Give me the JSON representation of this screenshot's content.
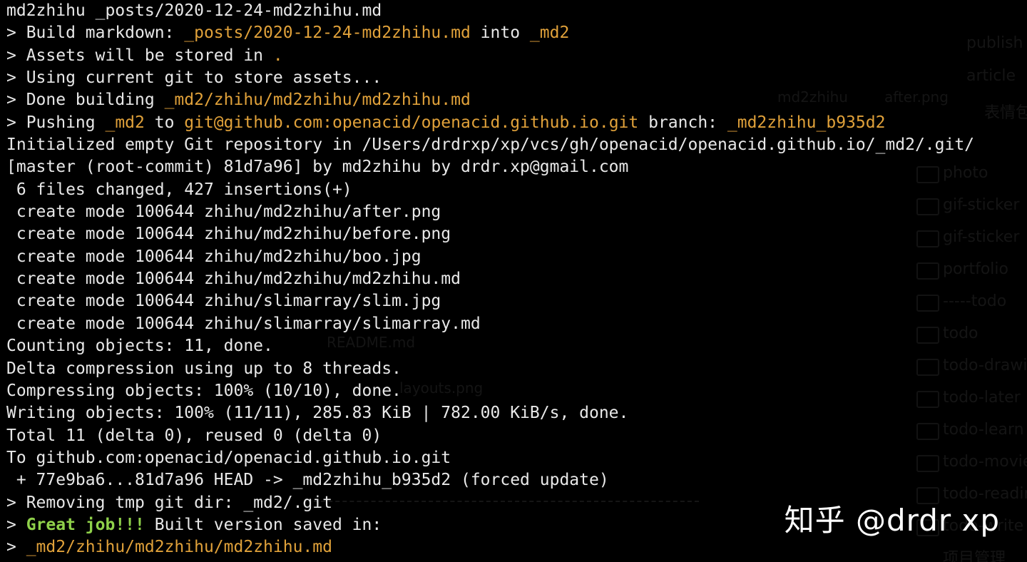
{
  "terminal": {
    "lines": [
      [
        {
          "t": "md2zhihu _posts/2020-12-24-md2zhihu.md",
          "c": "white"
        }
      ],
      [
        {
          "t": "> Build markdown: ",
          "c": "white"
        },
        {
          "t": "_posts/2020-12-24-md2zhihu.md",
          "c": "yellow"
        },
        {
          "t": " into ",
          "c": "white"
        },
        {
          "t": "_md2",
          "c": "yellow"
        }
      ],
      [
        {
          "t": "> Assets will be stored in ",
          "c": "white"
        },
        {
          "t": ".",
          "c": "yellow"
        }
      ],
      [
        {
          "t": "> Using current git to store assets...",
          "c": "white"
        }
      ],
      [
        {
          "t": "> Done building ",
          "c": "white"
        },
        {
          "t": "_md2/zhihu/md2zhihu/md2zhihu.md",
          "c": "yellow"
        }
      ],
      [
        {
          "t": "> Pushing ",
          "c": "white"
        },
        {
          "t": "_md2",
          "c": "yellow"
        },
        {
          "t": " to ",
          "c": "white"
        },
        {
          "t": "git@github.com:openacid/openacid.github.io.git",
          "c": "yellow"
        },
        {
          "t": " branch: ",
          "c": "white"
        },
        {
          "t": "_md2zhihu_b935d2",
          "c": "yellow"
        }
      ],
      [
        {
          "t": "Initialized empty Git repository in /Users/drdrxp/xp/vcs/gh/openacid/openacid.github.io/_md2/.git/",
          "c": "white"
        }
      ],
      [
        {
          "t": "[master (root-commit) 81d7a96] by md2zhihu by drdr.xp@gmail.com",
          "c": "white"
        }
      ],
      [
        {
          "t": " 6 files changed, 427 insertions(+)",
          "c": "white"
        }
      ],
      [
        {
          "t": " create mode 100644 zhihu/md2zhihu/after.png",
          "c": "white"
        }
      ],
      [
        {
          "t": " create mode 100644 zhihu/md2zhihu/before.png",
          "c": "white"
        }
      ],
      [
        {
          "t": " create mode 100644 zhihu/md2zhihu/boo.jpg",
          "c": "white"
        }
      ],
      [
        {
          "t": " create mode 100644 zhihu/md2zhihu/md2zhihu.md",
          "c": "white"
        }
      ],
      [
        {
          "t": " create mode 100644 zhihu/slimarray/slim.jpg",
          "c": "white"
        }
      ],
      [
        {
          "t": " create mode 100644 zhihu/slimarray/slimarray.md",
          "c": "white"
        }
      ],
      [
        {
          "t": "Counting objects: 11, done.",
          "c": "white"
        }
      ],
      [
        {
          "t": "Delta compression using up to 8 threads.",
          "c": "white"
        }
      ],
      [
        {
          "t": "Compressing objects: 100% (10/10), done.",
          "c": "white"
        }
      ],
      [
        {
          "t": "Writing objects: 100% (11/11), 285.83 KiB | 782.00 KiB/s, done.",
          "c": "white"
        }
      ],
      [
        {
          "t": "Total 11 (delta 0), reused 0 (delta 0)",
          "c": "white"
        }
      ],
      [
        {
          "t": "To github.com:openacid/openacid.github.io.git",
          "c": "white"
        }
      ],
      [
        {
          "t": " + 77e9ba6...81d7a96 HEAD -> _md2zhihu_b935d2 (forced update)",
          "c": "white"
        }
      ],
      [
        {
          "t": "> Removing tmp git dir: _md2/.git",
          "c": "white"
        }
      ],
      [
        {
          "t": "> ",
          "c": "white"
        },
        {
          "t": "Great job!!!",
          "c": "green"
        },
        {
          "t": " Built version saved in:",
          "c": "white"
        }
      ],
      [
        {
          "t": "> ",
          "c": "white"
        },
        {
          "t": "_md2/zhihu/md2zhihu/md2zhihu.md",
          "c": "yellow"
        }
      ]
    ]
  },
  "watermark": {
    "text": "知乎 @drdr xp"
  },
  "background": {
    "sidebar_items": [
      "publish",
      "article",
      "表情包",
      "photo",
      "gif-sticker",
      "gif-sticker",
      "portfolio",
      "-----todo",
      "todo",
      "todo-drawing",
      "todo-later",
      "todo-learn",
      "todo-movie",
      "todo-reading",
      "todo-write",
      "项目管理"
    ],
    "breadcrumb_item": "md2zhihu",
    "breadcrumb_file": "after.png",
    "file_items": [
      "README.md",
      "layouts.png"
    ]
  },
  "colors": {
    "background": "#000000",
    "text": "#e8e8e8",
    "path_yellow": "#e0a13a",
    "success_green": "#8fd14a",
    "watermark": "#ffffff"
  }
}
